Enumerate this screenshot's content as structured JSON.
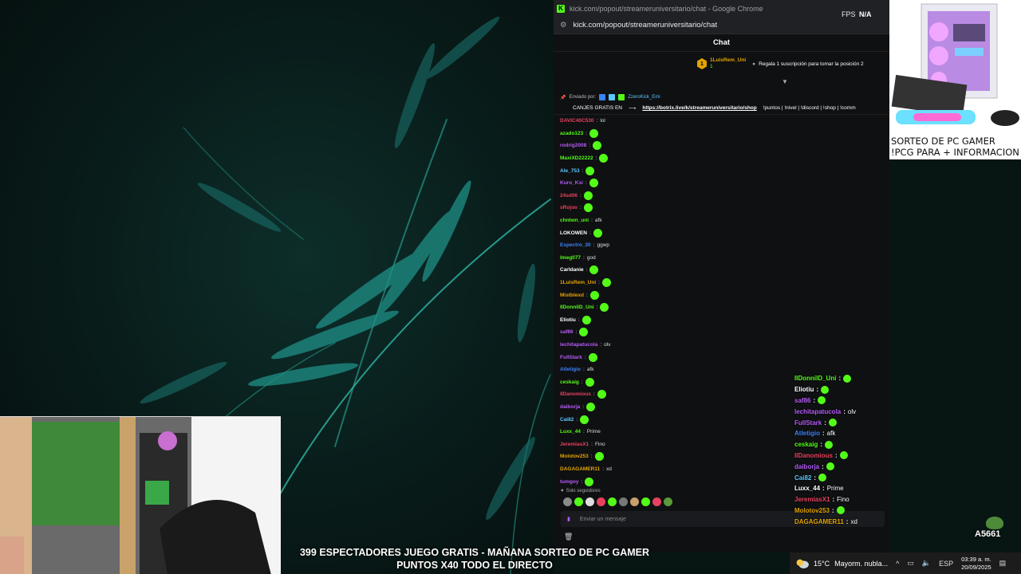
{
  "browser": {
    "window_title": "kick.com/popout/streameruniversitario/chat - Google Chrome",
    "url": "kick.com/popout/streameruniversitario/chat"
  },
  "obs": {
    "fps_label": "FPS",
    "fps_value": "N/A"
  },
  "chat": {
    "header": "Chat",
    "pinned_sub": {
      "badge": "1",
      "user": "1LuisRem_Uni",
      "count": "1",
      "text": "Regala 1 suscripción para tomar la posición 2"
    },
    "sent_by_label": "Enviado por:",
    "sent_by_user": "ZzeroKick_Emi",
    "pinned_message": "CANJES GRATIS EN",
    "pinned_link": "https://botrix.live/k/streameruniversitario/shop",
    "pinned_tail": "!puntos | !nivel | !discord | !shop | !comm",
    "messages": [
      {
        "user": "DAVIC40C530",
        "text": "lol",
        "color": "#e8415f"
      },
      {
        "user": "azado123",
        "text": "",
        "color": "#53fc18"
      },
      {
        "user": "rodrig2008",
        "text": "",
        "color": "#b35bf5"
      },
      {
        "user": "MaxiXD22222",
        "text": "",
        "color": "#53fc18"
      },
      {
        "user": "Ale_753",
        "text": "",
        "color": "#5bc8ff"
      },
      {
        "user": "Kuro_Ksi",
        "text": "",
        "color": "#b35bf5"
      },
      {
        "user": "24sd06",
        "text": "",
        "color": "#e8415f"
      },
      {
        "user": "sRojoo",
        "text": "",
        "color": "#e8415f"
      },
      {
        "user": "chntwn_uni",
        "text": "afk",
        "color": "#53fc18"
      },
      {
        "user": "LOKOWEN",
        "text": "",
        "color": "#ffffff"
      },
      {
        "user": "Espectro_30",
        "text": "ggwp",
        "color": "#3b82f6"
      },
      {
        "user": "lmeg077",
        "text": "god",
        "color": "#53fc18"
      },
      {
        "user": "Carldanie",
        "text": "",
        "color": "#ffffff"
      },
      {
        "user": "1LuisRem_Uni",
        "text": "",
        "color": "#e2a400"
      },
      {
        "user": "Mistblexd",
        "text": "",
        "color": "#e2a400"
      },
      {
        "user": "IIDonnilD_Uni",
        "text": "",
        "color": "#53fc18"
      },
      {
        "user": "Eliotiu",
        "text": "",
        "color": "#ffffff"
      },
      {
        "user": "saf86",
        "text": "",
        "color": "#b35bf5"
      },
      {
        "user": "lechitapatucola",
        "text": "olv",
        "color": "#b35bf5"
      },
      {
        "user": "FullStark",
        "text": "",
        "color": "#b35bf5"
      },
      {
        "user": "Atletigio",
        "text": "afk",
        "color": "#3b82f6"
      },
      {
        "user": "ceskaig",
        "text": "",
        "color": "#53fc18"
      },
      {
        "user": "IIDanomious",
        "text": "",
        "color": "#e8415f"
      },
      {
        "user": "daiborja",
        "text": "",
        "color": "#b35bf5"
      },
      {
        "user": "Cai82",
        "text": "",
        "color": "#5bc8ff"
      },
      {
        "user": "Luxx_44",
        "text": "Prime",
        "color": "#53fc18"
      },
      {
        "user": "JeremiasX1",
        "text": "Fino",
        "color": "#e8415f"
      },
      {
        "user": "Molotov253",
        "text": "",
        "color": "#e2a400"
      },
      {
        "user": "DAGAGAMER11",
        "text": "xd",
        "color": "#e2a400"
      },
      {
        "user": "tumgoy",
        "text": "",
        "color": "#b35bf5"
      }
    ],
    "followers_only": "Solo seguidores",
    "input_placeholder": "Enviar un mensaje"
  },
  "promo": {
    "line1": "SORTEO DE PC GAMER",
    "line2": "!PCG PARA + INFORMACION"
  },
  "overlay": {
    "messages": [
      {
        "user": "IIDonnilD_Uni",
        "text": "",
        "color": "#53fc18"
      },
      {
        "user": "Eliotiu",
        "text": "",
        "color": "#ffffff"
      },
      {
        "user": "saf86",
        "text": "",
        "color": "#b35bf5"
      },
      {
        "user": "lechitapatucola",
        "text": "olv",
        "color": "#b35bf5"
      },
      {
        "user": "FullStark",
        "text": "",
        "color": "#b35bf5"
      },
      {
        "user": "Atletigio",
        "text": "afk",
        "color": "#3b82f6"
      },
      {
        "user": "ceskaig",
        "text": "",
        "color": "#53fc18"
      },
      {
        "user": "IIDanomious",
        "text": "",
        "color": "#e8415f"
      },
      {
        "user": "daiborja",
        "text": "",
        "color": "#b35bf5"
      },
      {
        "user": "Cai82",
        "text": "",
        "color": "#5bc8ff"
      },
      {
        "user": "Luxx_44",
        "text": "Prime",
        "color": "#ffffff"
      },
      {
        "user": "JeremiasX1",
        "text": "Fino",
        "color": "#e8415f"
      },
      {
        "user": "Molotov253",
        "text": "",
        "color": "#e2a400"
      },
      {
        "user": "DAGAGAMER11",
        "text": "xd",
        "color": "#e2a400"
      }
    ],
    "counter": "A5661"
  },
  "ticker": {
    "line1": "399 ESPECTADORES JUEGO GRATIS - MAÑANA SORTEO DE PC GAMER",
    "line2": "PUNTOS X40 TODO EL DIRECTO"
  },
  "taskbar": {
    "temperature": "15°C",
    "weather": "Mayorm. nubla...",
    "language": "ESP",
    "time": "03:39 a. m.",
    "date": "20/09/2025"
  }
}
